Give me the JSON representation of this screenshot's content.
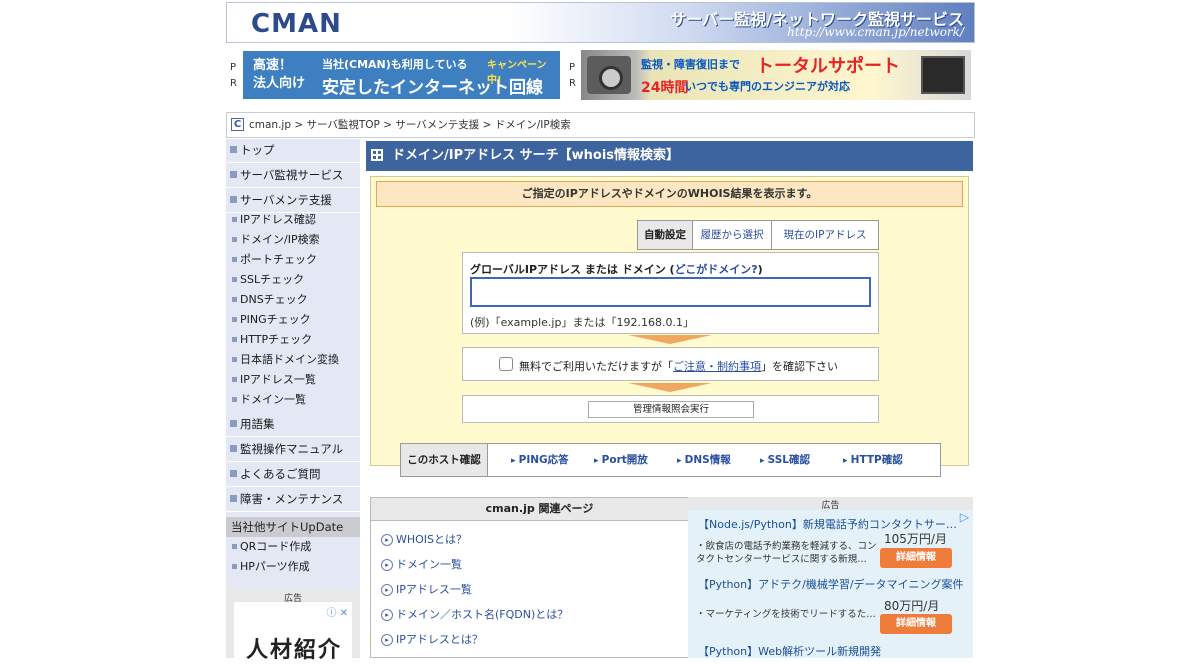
{
  "header": {
    "logo": "CMAN",
    "tagline": "サーバー監視/ネットワーク監視サービス",
    "url": "http://www.cman.jp/network/"
  },
  "pr": {
    "label": "P\nR",
    "banner1": {
      "left": "高速！\n法人向け",
      "top": "当社(CMAN)も利用している",
      "main": "安定したインターネット回線",
      "campaign": "キャンペーン中!"
    },
    "banner2": {
      "line1a": "監視・障害復旧まで",
      "line1b": "トータルサポート",
      "line2a": "24時間",
      "line2b": "いつでも専門のエンジニアが対応"
    }
  },
  "breadcrumb": {
    "icon": "C",
    "text": "cman.jp > サーバ監視TOP > サーバメンテ支援 > ドメイン/IP検索"
  },
  "sidebar": {
    "main_items": [
      "トップ",
      "サーバ監視サービス",
      "サーバメンテ支援"
    ],
    "sub_items": [
      "IPアドレス確認",
      "ドメイン/IP検索",
      "ポートチェック",
      "SSLチェック",
      "DNSチェック",
      "PINGチェック",
      "HTTPチェック",
      "日本語ドメイン変換",
      "IPアドレス一覧",
      "ドメイン一覧"
    ],
    "more_items": [
      "用語集",
      "監視操作マニュアル",
      "よくあるご質問",
      "障害・メンテナンス"
    ],
    "other_title": "当社他サイトUpDate",
    "other_items": [
      "QRコード作成",
      "HPパーツ作成"
    ],
    "ad_label": "広告",
    "ad_text": "人材紹介"
  },
  "main": {
    "title": "ドメイン/IPアドレス サーチ【whois情報検索】",
    "notice": "ご指定のIPアドレスやドメインのWHOIS結果を表示ます。",
    "tabs": [
      "自動設定",
      "履歴から選択",
      "現在のIPアドレス"
    ],
    "input_label": "グローバルIPアドレス または ドメイン (",
    "input_label_link": "どこがドメイン?",
    "input_label_end": ")",
    "input_value": "",
    "example": "(例)「example.jp」または「192.168.0.1」",
    "agree_text_a": "無料でご利用いただけますが「",
    "agree_link": "ご注意・制約事項",
    "agree_text_b": "」を確認下さい",
    "submit": "管理情報照会実行",
    "host_label": "このホスト確認",
    "host_links": [
      "PING応答",
      "Port開放",
      "DNS情報",
      "SSL確認",
      "HTTP確認"
    ]
  },
  "related": {
    "title": "cman.jp 関連ページ",
    "links": [
      "WHOISとは？",
      "ドメイン一覧",
      "IPアドレス一覧",
      "ドメイン／ホスト名(FQDN)とは？",
      "IPアドレスとは？"
    ]
  },
  "ad_right": {
    "label": "広告",
    "items": [
      {
        "title": "【Node.js/Python】新規電話予約コンタクトサー…",
        "desc": "・飲食店の電話予約業務を軽減する、コンタクトセンターサービスに関する新規…",
        "price": "105万円/月",
        "button": "詳細情報"
      },
      {
        "title": "【Python】アドテク/機械学習/データマイニング案件",
        "desc": "・マーケティングを技術でリードするた…",
        "price": "80万円/月",
        "button": "詳細情報"
      },
      {
        "title": "【Python】Web解析ツール新規開発"
      }
    ]
  }
}
